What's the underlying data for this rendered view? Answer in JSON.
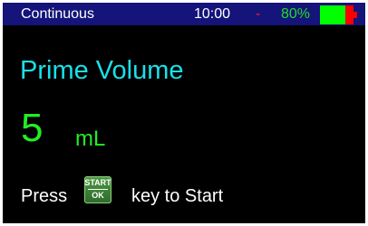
{
  "status_bar": {
    "mode": "Continuous",
    "time": "10:00",
    "separator": "-",
    "battery_percent": "80%",
    "battery_level": 0.8,
    "colors": {
      "background": "#14147a",
      "battery_ok": "#00ff00",
      "battery_low": "#ff0000"
    }
  },
  "main": {
    "title": "Prime Volume",
    "value": "5",
    "unit": "mL"
  },
  "instruction": {
    "before_key": "Press",
    "key_top": "START",
    "key_bottom": "OK",
    "key_icon": "start-ok-key-icon",
    "after_key": "key to Start"
  }
}
